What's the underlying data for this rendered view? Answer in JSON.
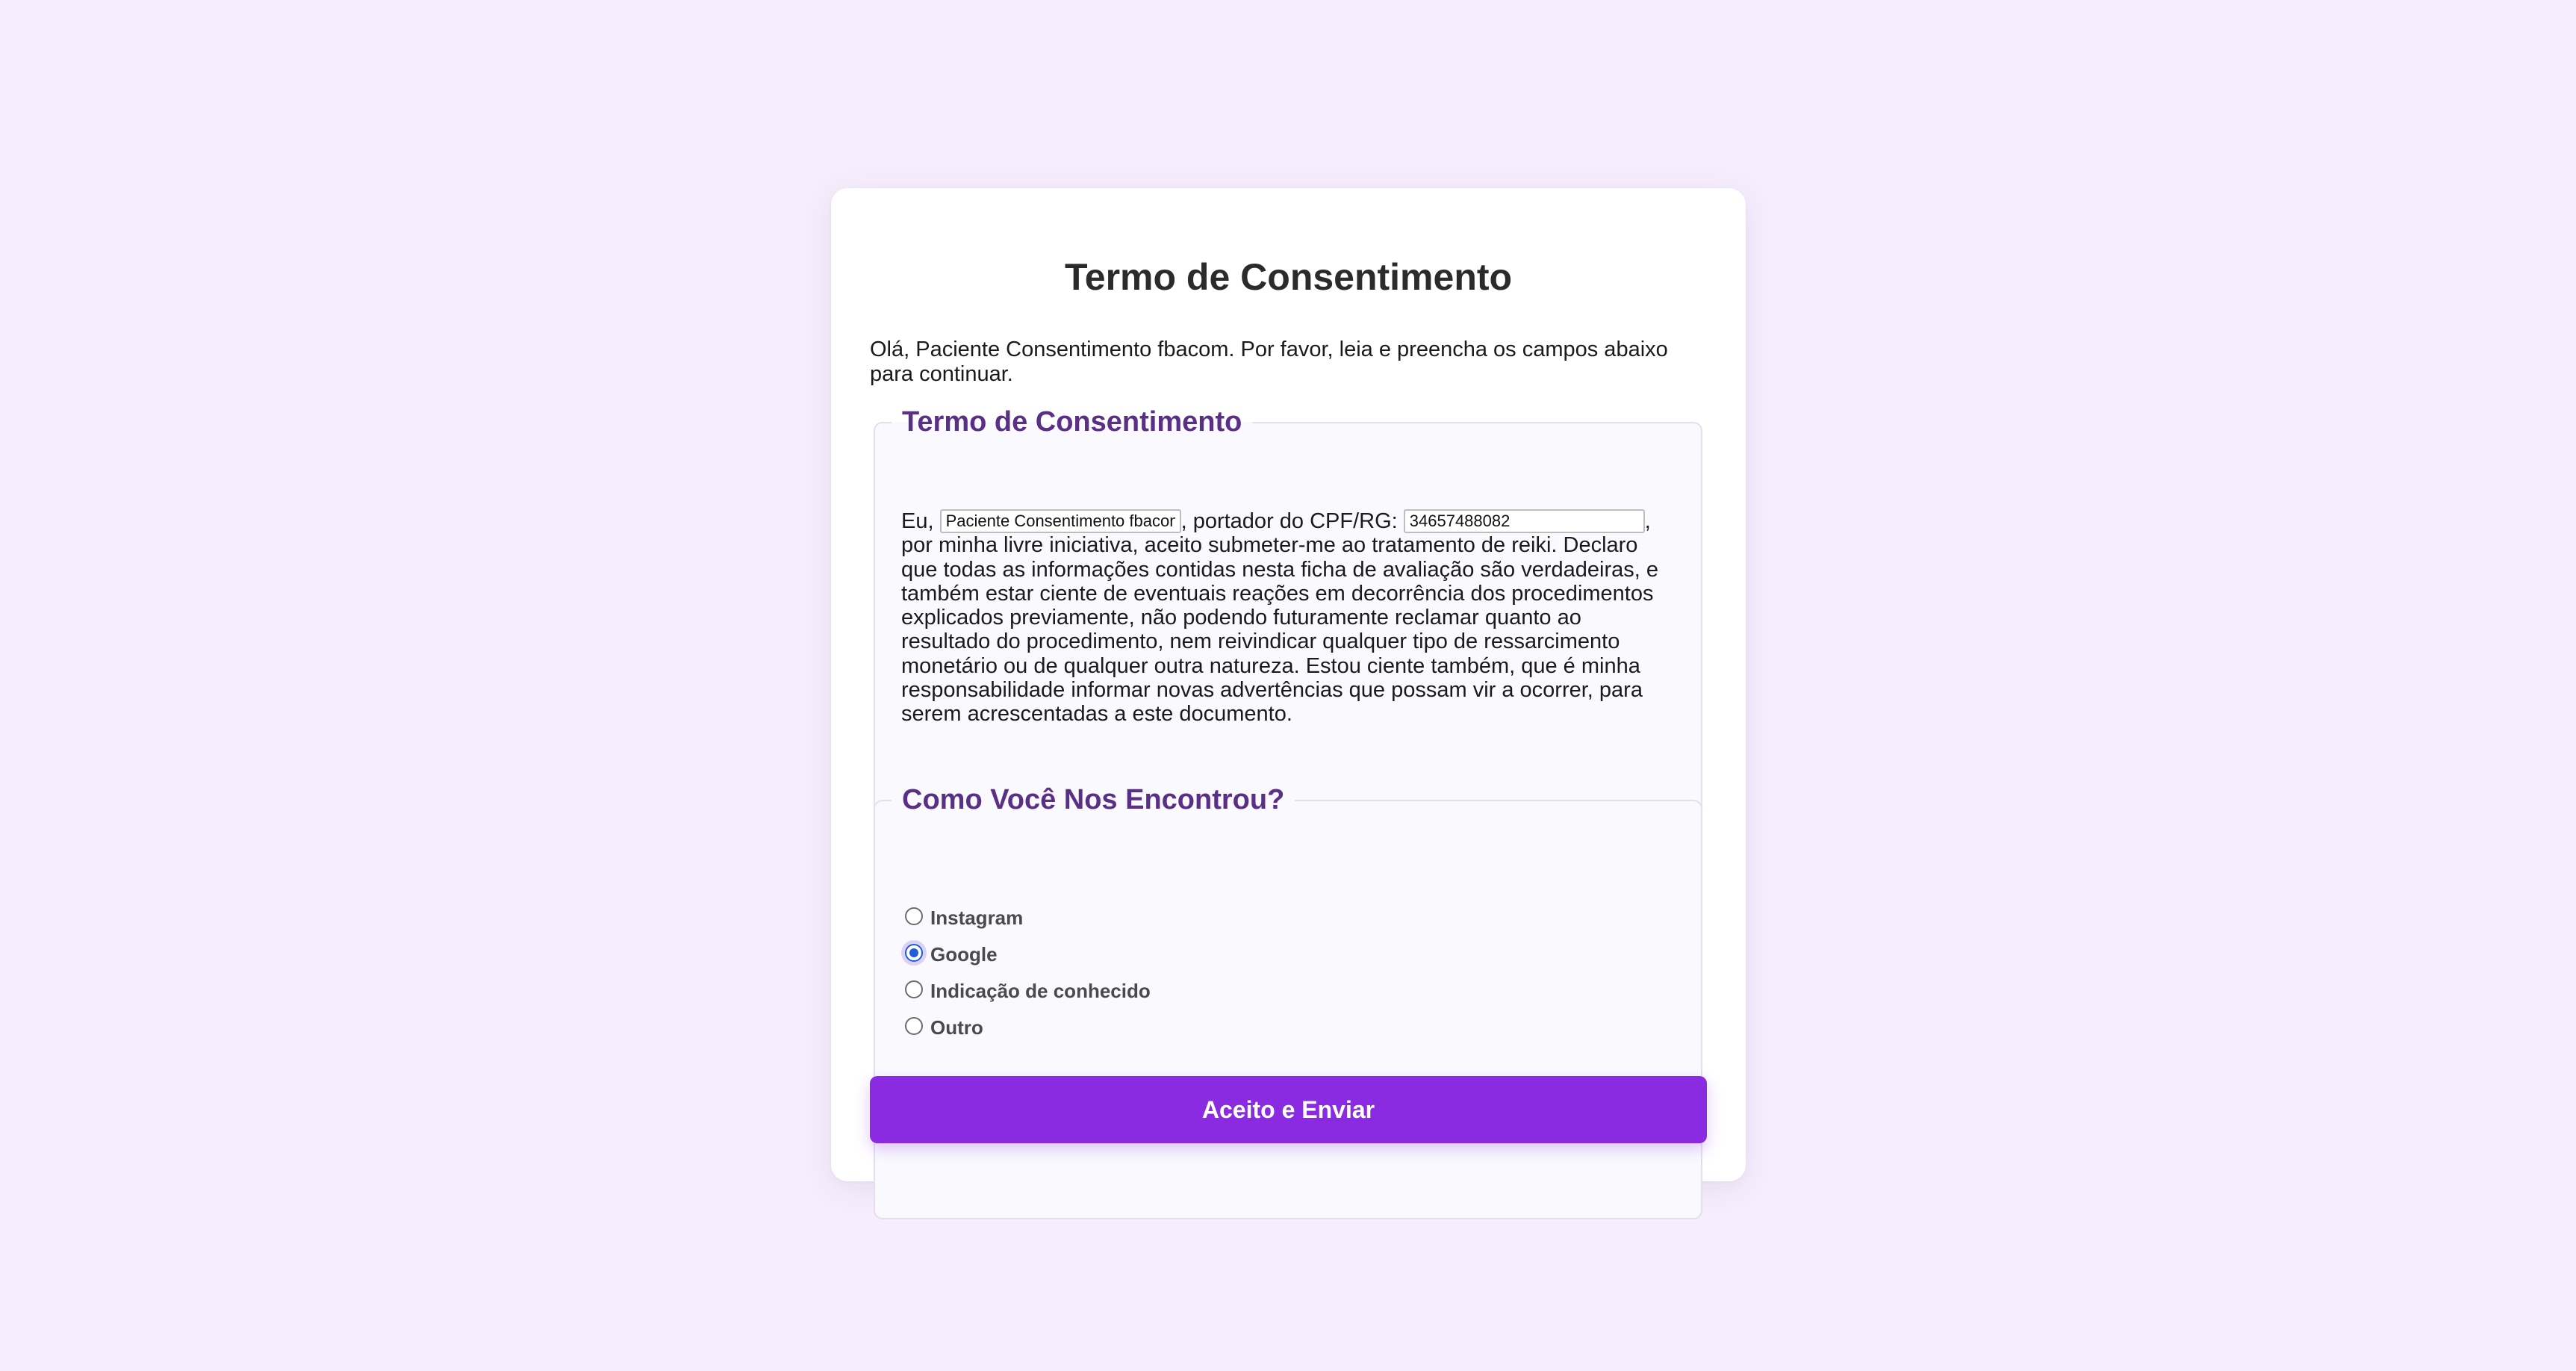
{
  "form": {
    "title": "Termo de Consentimento",
    "intro": "Olá, Paciente Consentimento fbacom. Por favor, leia e preencha os campos abaixo para continuar.",
    "terms": {
      "legend": "Termo de Consentimento",
      "prefix": "Eu, ",
      "name_value": "Paciente Consentimento fbacom",
      "middle": ", portador do CPF/RG: ",
      "cpf_value": "34657488082",
      "body": ", por minha livre iniciativa, aceito submeter-me ao tratamento de reiki. Declaro que todas as informações contidas nesta ficha de avaliação são verdadeiras, e também estar ciente de eventuais reações em decorrência dos procedimentos explicados previamente, não podendo futuramente reclamar quanto ao resultado do procedimento, nem reivindicar qualquer tipo de ressarcimento monetário ou de qualquer outra natureza. Estou ciente também, que é minha responsabilidade informar novas advertências que possam vir a ocorrer, para serem acrescentadas a este documento."
    },
    "source": {
      "legend": "Como Você Nos Encontrou?",
      "options": [
        {
          "label": "Instagram",
          "checked": false
        },
        {
          "label": "Google",
          "checked": true
        },
        {
          "label": "Indicação de conhecido",
          "checked": false
        },
        {
          "label": "Outro",
          "checked": false
        }
      ]
    },
    "submit_label": "Aceito e Enviar"
  },
  "colors": {
    "background": "#f6eefc",
    "accent": "#8a2be2",
    "legend": "#5a2f86",
    "radio_checked": "#1f5fd6"
  }
}
